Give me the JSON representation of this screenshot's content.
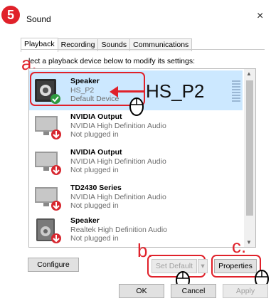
{
  "step_number": "5",
  "window": {
    "title": "Sound",
    "close": "×"
  },
  "tabs": [
    "Playback",
    "Recording",
    "Sounds",
    "Communications"
  ],
  "instruction": "lect a playback device below to modify its settings:",
  "annotations": {
    "a": "a.",
    "b": "b.",
    "c": "c.",
    "hs_label": "HS_P2",
    "accent": "#e0212a"
  },
  "devices": [
    {
      "name": "Speaker",
      "description": "HS_P2",
      "status": "Default Device",
      "icon": "headset-speaker-icon",
      "badge": "check-badge-icon",
      "selected": true
    },
    {
      "name": "NVIDIA Output",
      "description": "NVIDIA High Definition Audio",
      "status": "Not plugged in",
      "icon": "monitor-icon",
      "badge": "down-arrow-badge-icon"
    },
    {
      "name": "NVIDIA Output",
      "description": "NVIDIA High Definition Audio",
      "status": "Not plugged in",
      "icon": "monitor-icon",
      "badge": "down-arrow-badge-icon"
    },
    {
      "name": "TD2430 Series",
      "description": "NVIDIA High Definition Audio",
      "status": "Not plugged in",
      "icon": "monitor-icon",
      "badge": "down-arrow-badge-icon"
    },
    {
      "name": "Speaker",
      "description": "Realtek High Definition Audio",
      "status": "Not plugged in",
      "icon": "speaker-icon",
      "badge": "down-arrow-badge-icon"
    }
  ],
  "buttons": {
    "configure": "Configure",
    "set_default": "Set Default",
    "properties": "Properties",
    "ok": "OK",
    "cancel": "Cancel",
    "apply": "Apply"
  }
}
